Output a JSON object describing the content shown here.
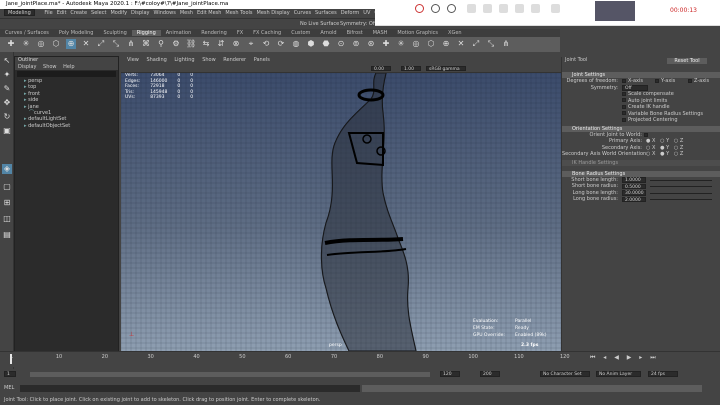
{
  "window": {
    "title": "Jane_jointPlace.ma* - Autodesk Maya 2020.1 : F:\\#coloy#\\7\\#Jane_jointPlace.ma"
  },
  "menubar": {
    "mode": "Modeling",
    "items": [
      "File",
      "Edit",
      "Create",
      "Select",
      "Modify",
      "Display",
      "Windows",
      "Mesh",
      "Edit Mesh",
      "Mesh Tools",
      "Mesh Display",
      "Curves",
      "Surfaces",
      "Deform",
      "UV",
      "Generate",
      "Cache",
      "mGear",
      "Arnold",
      "Help"
    ]
  },
  "statusline": {
    "live_surface": "No Live Surface",
    "symmetry": "Symmetry: Off",
    "sign_in": "Sign In"
  },
  "recorder": {
    "time": "00:00:13"
  },
  "shelf": {
    "tabs": [
      "Curves / Surfaces",
      "Poly Modeling",
      "Sculpting",
      "Rigging",
      "Animation",
      "Rendering",
      "FX",
      "FX Caching",
      "Custom",
      "Arnold",
      "Bifrost",
      "MASH",
      "Motion Graphics",
      "XGen"
    ],
    "active": 3
  },
  "outliner": {
    "title": "Outliner",
    "menus": [
      "Display",
      "Show",
      "Help"
    ],
    "items": [
      {
        "label": "persp",
        "indent": 1
      },
      {
        "label": "top",
        "indent": 1
      },
      {
        "label": "front",
        "indent": 1
      },
      {
        "label": "side",
        "indent": 1
      },
      {
        "label": "jane",
        "indent": 1
      },
      {
        "label": "curve1",
        "indent": 2
      },
      {
        "label": "defaultLightSet",
        "indent": 1
      },
      {
        "label": "defaultObjectSet",
        "indent": 1
      }
    ]
  },
  "viewport": {
    "menus": [
      "View",
      "Shading",
      "Lighting",
      "Show",
      "Renderer",
      "Panels"
    ],
    "gamma": "sRGB gamma",
    "exposure": "0.00",
    "gamma_val": "1.00",
    "stats": [
      [
        "Verts:",
        "73064",
        "0",
        "0"
      ],
      [
        "Edges:",
        "146000",
        "0",
        "0"
      ],
      [
        "Faces:",
        "72918",
        "0",
        "0"
      ],
      [
        "Tris:",
        "145948",
        "0",
        "0"
      ],
      [
        "UVs:",
        "87393",
        "0",
        "0"
      ]
    ],
    "hud": [
      [
        "Evaluation:",
        "Parallel"
      ],
      [
        "EM State:",
        "Ready"
      ],
      [
        "GPU Override:",
        "Enabled (89k)"
      ]
    ],
    "fps": "2.3 fps",
    "camera": "persp"
  },
  "tool_settings": {
    "title": "Joint Tool",
    "reset": "Reset Tool",
    "joint_section": "Joint Settings",
    "dof_label": "Degrees of freedom:",
    "dof": [
      "X-axis",
      "Y-axis",
      "Z-axis"
    ],
    "symmetry_label": "Symmetry:",
    "symmetry_val": "Off",
    "checks": [
      "Scale compensate",
      "Auto joint limits",
      "Create IK handle",
      "Variable Bone Radius Settings",
      "Projected Centering"
    ],
    "orient_section": "Orientation Settings",
    "orient_world": "Orient Joint to World:",
    "primary": "Primary Axis:",
    "secondary": "Secondary Axis:",
    "sec_world": "Secondary Axis World Orientation:",
    "ik_section": "IK Handle Settings",
    "bone_section": "Bone Radius Settings",
    "bone_rows": [
      [
        "Short bone length:",
        "1.0000"
      ],
      [
        "Short bone radius:",
        "0.5000"
      ],
      [
        "Long bone length:",
        "30.0000"
      ],
      [
        "Long bone radius:",
        "2.0000"
      ]
    ]
  },
  "timeline": {
    "ticks": [
      "1",
      "10",
      "20",
      "30",
      "40",
      "50",
      "60",
      "70",
      "80",
      "90",
      "100",
      "110",
      "120"
    ],
    "start": "1",
    "end": "120",
    "range_end": "200",
    "character_set": "No Character Set",
    "anim_layer": "No Anim Layer",
    "fps": "24 fps"
  },
  "mel": {
    "label": "MEL"
  },
  "help": {
    "text": "Joint Tool: Click to place joint. Click on existing joint to add to skeleton. Click drag to position joint. Enter to complete skeleton."
  }
}
